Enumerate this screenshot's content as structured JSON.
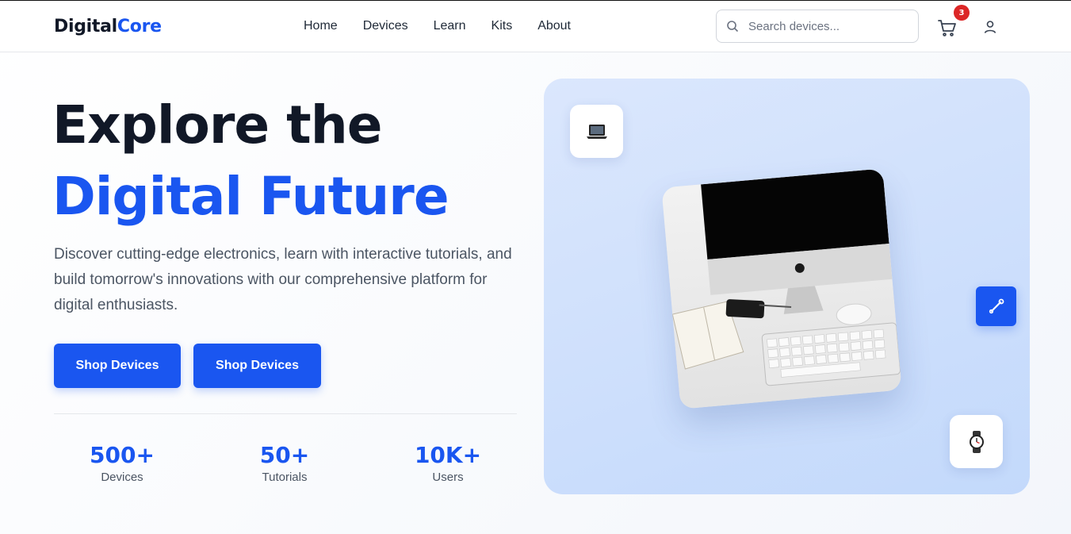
{
  "brand": {
    "name_part1": "Digital",
    "name_part2": "Core",
    "accent_color": "#1a56f0"
  },
  "nav": {
    "items": [
      {
        "label": "Home"
      },
      {
        "label": "Devices"
      },
      {
        "label": "Learn"
      },
      {
        "label": "Kits"
      },
      {
        "label": "About"
      }
    ]
  },
  "search": {
    "placeholder": "Search devices...",
    "icon": "search-icon"
  },
  "cart": {
    "icon": "cart-icon",
    "count": "3"
  },
  "account": {
    "icon": "user-icon"
  },
  "hero": {
    "title_line1": "Explore the",
    "title_line2": "Digital Future",
    "description": "Discover cutting-edge electronics, learn with interactive tutorials, and build tomorrow's innovations with our comprehensive platform for digital enthusiasts.",
    "buttons": [
      {
        "label": "Shop Devices"
      },
      {
        "label": "Shop Devices"
      }
    ],
    "stats": [
      {
        "value": "500+",
        "label": "Devices"
      },
      {
        "value": "50+",
        "label": "Tutorials"
      },
      {
        "value": "10K+",
        "label": "Users"
      }
    ]
  },
  "showcase": {
    "image": "computer-desk-image",
    "floating_icons": [
      "laptop-icon",
      "wrench-icon",
      "watch-icon"
    ]
  }
}
